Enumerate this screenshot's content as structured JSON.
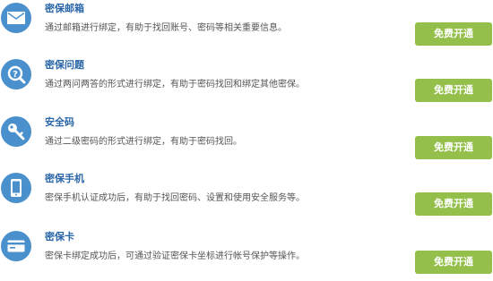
{
  "accent": "#93bf4a",
  "icon_color": "#4a90cc",
  "items": [
    {
      "icon": "mail-icon",
      "title": "密保邮箱",
      "description": "通过邮箱进行绑定，有助于找回账号、密码等相关重要信息。",
      "button": "免费开通"
    },
    {
      "icon": "question-icon",
      "title": "密保问题",
      "description": "通过两问两答的形式进行绑定，有助于密码找回和绑定其他密保。",
      "button": "免费开通"
    },
    {
      "icon": "key-icon",
      "title": "安全码",
      "description": "通过二级密码的形式进行绑定，有助于密码找回。",
      "button": "免费开通"
    },
    {
      "icon": "phone-icon",
      "title": "密保手机",
      "description": "密保手机认证成功后，有助于找回密码、设置和使用安全服务等。",
      "button": "免费开通"
    },
    {
      "icon": "card-icon",
      "title": "密保卡",
      "description": "密保卡绑定成功后，可通过验证密保卡坐标进行帐号保护等操作。",
      "button": "免费开通"
    }
  ]
}
